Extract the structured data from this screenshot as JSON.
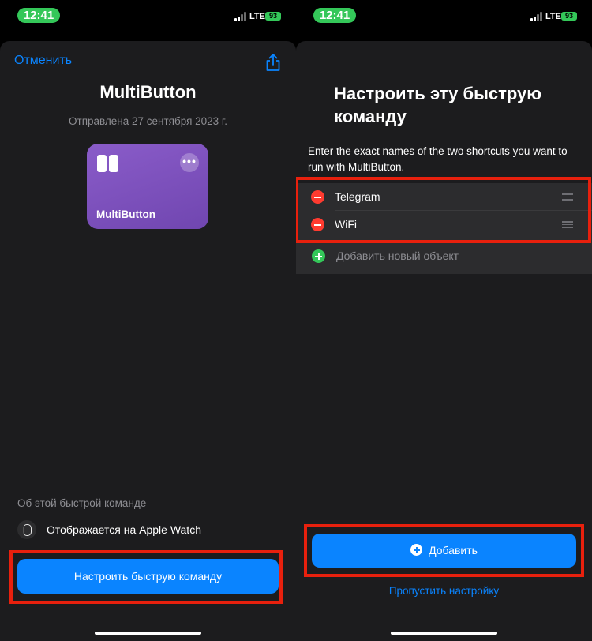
{
  "status": {
    "time": "12:41",
    "network": "LTE",
    "battery": "93"
  },
  "left": {
    "cancel_label": "Отменить",
    "title": "MultiButton",
    "sent_date": "Отправлена 27 сентября 2023 г.",
    "card_name": "MultiButton",
    "card_more": "•••",
    "about_heading": "Об этой быстрой команде",
    "watch_label": "Отображается на Apple Watch",
    "setup_button": "Настроить быструю команду"
  },
  "right": {
    "title": "Настроить эту быструю команду",
    "instructions": "Enter the exact names of the two shortcuts you want to run with MultiButton.",
    "items": [
      {
        "label": "Telegram"
      },
      {
        "label": "WiFi"
      }
    ],
    "add_item_label": "Добавить новый объект",
    "add_button": "Добавить",
    "skip_label": "Пропустить настройку"
  },
  "colors": {
    "accent": "#0a84ff",
    "highlight": "#e8200d",
    "card": "#7a4fbd",
    "status_green": "#34c759"
  }
}
